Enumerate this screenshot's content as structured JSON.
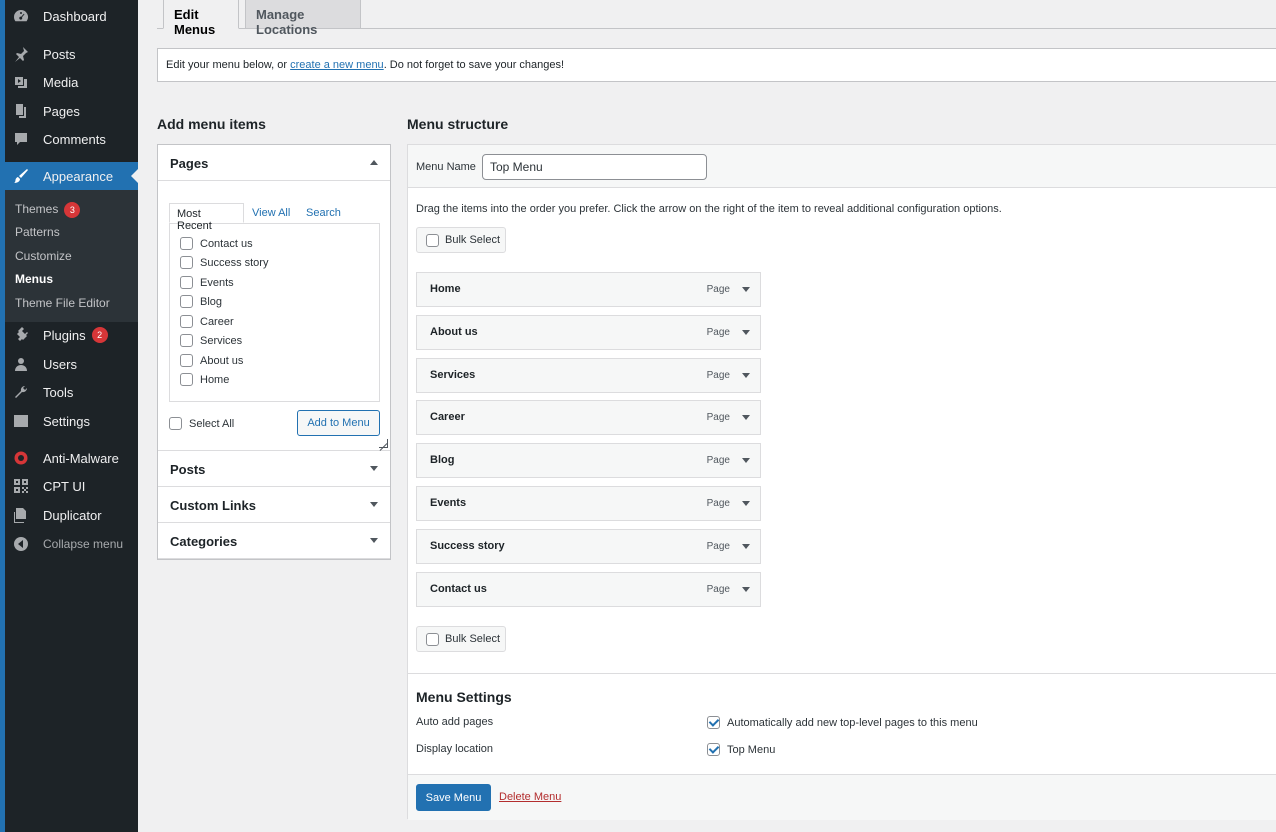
{
  "sidebar": {
    "items": [
      {
        "label": "Dashboard",
        "icon": "dashboard-icon"
      },
      {
        "label": "Posts",
        "icon": "pin-icon"
      },
      {
        "label": "Media",
        "icon": "media-icon"
      },
      {
        "label": "Pages",
        "icon": "pages-icon"
      },
      {
        "label": "Comments",
        "icon": "comment-icon"
      },
      {
        "label": "Appearance",
        "icon": "brush-icon"
      },
      {
        "label": "Plugins",
        "icon": "plugin-icon",
        "badge": "2"
      },
      {
        "label": "Users",
        "icon": "user-icon"
      },
      {
        "label": "Tools",
        "icon": "wrench-icon"
      },
      {
        "label": "Settings",
        "icon": "settings-icon"
      },
      {
        "label": "Anti-Malware",
        "icon": "shield-icon"
      },
      {
        "label": "CPT UI",
        "icon": "grid-icon"
      },
      {
        "label": "Duplicator",
        "icon": "duplicator-icon"
      }
    ],
    "submenu": [
      {
        "label": "Themes",
        "badge": "3"
      },
      {
        "label": "Patterns"
      },
      {
        "label": "Customize"
      },
      {
        "label": "Menus"
      },
      {
        "label": "Theme File Editor"
      }
    ],
    "collapse_label": "Collapse menu"
  },
  "tabs": {
    "edit": "Edit Menus",
    "manage": "Manage Locations"
  },
  "notice": {
    "before": "Edit your menu below, or ",
    "link": "create a new menu",
    "after": ". Do not forget to save your changes!"
  },
  "add_items": {
    "title": "Add menu items",
    "pages": {
      "heading": "Pages",
      "tabs": [
        "Most Recent",
        "View All",
        "Search"
      ],
      "items": [
        "Contact us",
        "Success story",
        "Events",
        "Blog",
        "Career",
        "Services",
        "About us",
        "Home"
      ],
      "select_all": "Select All",
      "add_button": "Add to Menu"
    },
    "sections": [
      "Posts",
      "Custom Links",
      "Categories"
    ]
  },
  "structure": {
    "title": "Menu structure",
    "menu_name_label": "Menu Name",
    "menu_name_value": "Top Menu",
    "help_text": "Drag the items into the order you prefer. Click the arrow on the right of the item to reveal additional configuration options.",
    "bulk_select": "Bulk Select",
    "items": [
      {
        "title": "Home",
        "type": "Page"
      },
      {
        "title": "About us",
        "type": "Page"
      },
      {
        "title": "Services",
        "type": "Page"
      },
      {
        "title": "Career",
        "type": "Page"
      },
      {
        "title": "Blog",
        "type": "Page"
      },
      {
        "title": "Events",
        "type": "Page"
      },
      {
        "title": "Success story",
        "type": "Page"
      },
      {
        "title": "Contact us",
        "type": "Page"
      }
    ],
    "settings": {
      "title": "Menu Settings",
      "auto_add_label": "Auto add pages",
      "auto_add_value": "Automatically add new top-level pages to this menu",
      "auto_add_checked": true,
      "location_label": "Display location",
      "location_value": "Top Menu",
      "location_checked": true
    },
    "save_button": "Save Menu",
    "delete_link": "Delete Menu"
  },
  "colors": {
    "sidebar_bg": "#1d2327",
    "accent": "#2271b1",
    "badge": "#d63638",
    "delete": "#b32d2e"
  }
}
